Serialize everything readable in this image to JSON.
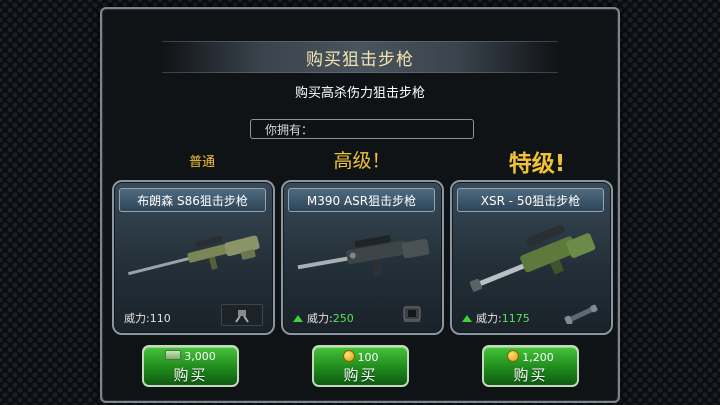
{
  "dialog": {
    "title": "购买狙击步枪",
    "subtitle": "购买高杀伤力狙击步枪",
    "own_label": "你拥有："
  },
  "cards": [
    {
      "grade": "普通",
      "grade_color": "#f1c232",
      "name": "布朗森 S86狙击步枪",
      "power_label": "威力:",
      "power_value": "110",
      "power_up": false,
      "price": "3,000",
      "currency_icon": "cash-icon",
      "buy_label": "购买"
    },
    {
      "grade": "高级！",
      "grade_color": "#f1c232",
      "name": "M390 ASR狙击步枪",
      "power_label": "威力:",
      "power_value": "250",
      "power_up": true,
      "price": "100",
      "currency_icon": "gold-coin-icon",
      "buy_label": "购买"
    },
    {
      "grade": "特级!",
      "grade_color": "#f1c232",
      "name": "XSR - 50狙击步枪",
      "power_label": "威力:",
      "power_value": "1175",
      "power_up": true,
      "price": "1,200",
      "currency_icon": "gold-coin-icon",
      "buy_label": "购买"
    }
  ]
}
